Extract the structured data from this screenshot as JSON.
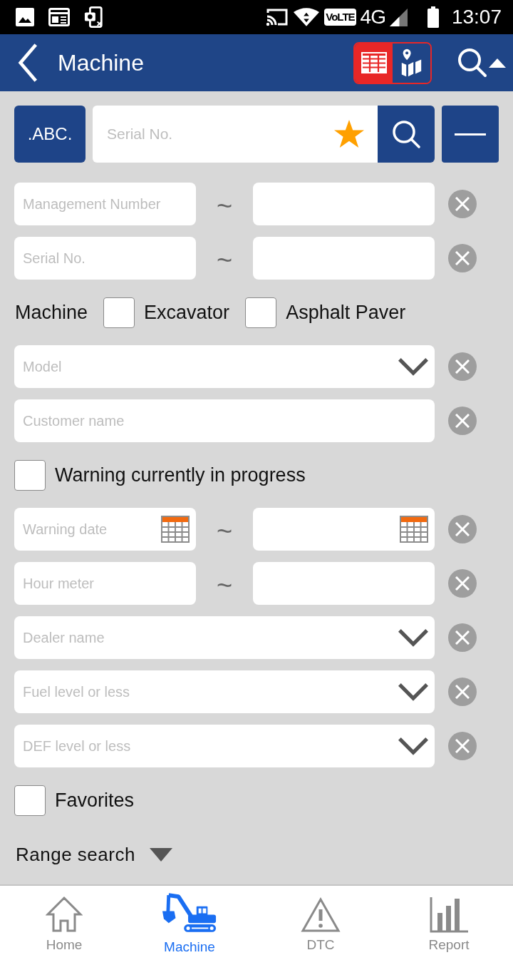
{
  "status_bar": {
    "volte": "VoLTE",
    "network": "4G",
    "time": "13:07"
  },
  "header": {
    "title": "Machine",
    "view_toggle": [
      {
        "kind": "table",
        "selected": true
      },
      {
        "kind": "map",
        "selected": false
      }
    ],
    "search_expanded": true
  },
  "search_bar": {
    "mode_button": ".ABC.",
    "placeholder": "Serial No."
  },
  "form": {
    "rows": [
      {
        "kind": "range",
        "placeholder": "Management Number",
        "separator": "~"
      },
      {
        "kind": "range",
        "placeholder": "Serial No.",
        "separator": "~"
      },
      {
        "kind": "checkbox_group",
        "label": "Machine",
        "options": [
          {
            "label": "Excavator",
            "checked": false
          },
          {
            "label": "Asphalt Paver",
            "checked": false
          }
        ]
      },
      {
        "kind": "select",
        "placeholder": "Model"
      },
      {
        "kind": "text",
        "placeholder": "Customer name"
      },
      {
        "kind": "checkbox",
        "label": "Warning currently in progress",
        "checked": false
      },
      {
        "kind": "date_range",
        "placeholder": "Warning date",
        "separator": "~"
      },
      {
        "kind": "range",
        "placeholder": "Hour meter",
        "separator": "~"
      },
      {
        "kind": "select",
        "placeholder": "Dealer name"
      },
      {
        "kind": "select",
        "placeholder": "Fuel level or less"
      },
      {
        "kind": "select",
        "placeholder": "DEF level or less"
      },
      {
        "kind": "checkbox",
        "label": "Favorites",
        "checked": false
      }
    ]
  },
  "range_search": {
    "label": "Range search",
    "expanded": false
  },
  "nav": {
    "items": [
      {
        "kind": "home",
        "label": "Home",
        "selected": false
      },
      {
        "kind": "machine",
        "label": "Machine",
        "selected": true
      },
      {
        "kind": "dtc",
        "label": "DTC",
        "selected": false
      },
      {
        "kind": "report",
        "label": "Report",
        "selected": false
      }
    ]
  }
}
